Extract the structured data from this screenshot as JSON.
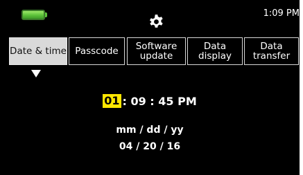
{
  "status_bar": {
    "battery_icon": "battery-full-icon",
    "battery_color": "#5cc23a",
    "settings_icon": "gear-icon",
    "clock": "1:09 PM"
  },
  "tabs": [
    {
      "label": "Date & time",
      "active": true
    },
    {
      "label": "Passcode",
      "active": false
    },
    {
      "label": "Software\nupdate",
      "active": false
    },
    {
      "label": "Data\ndisplay",
      "active": false
    },
    {
      "label": "Data\ntransfer",
      "active": false
    }
  ],
  "time": {
    "hour": "01",
    "rest": ": 09 : 45 PM",
    "highlight_color": "#ffe600"
  },
  "date": {
    "format": "mm / dd / yy",
    "value": "04 / 20 / 16"
  }
}
